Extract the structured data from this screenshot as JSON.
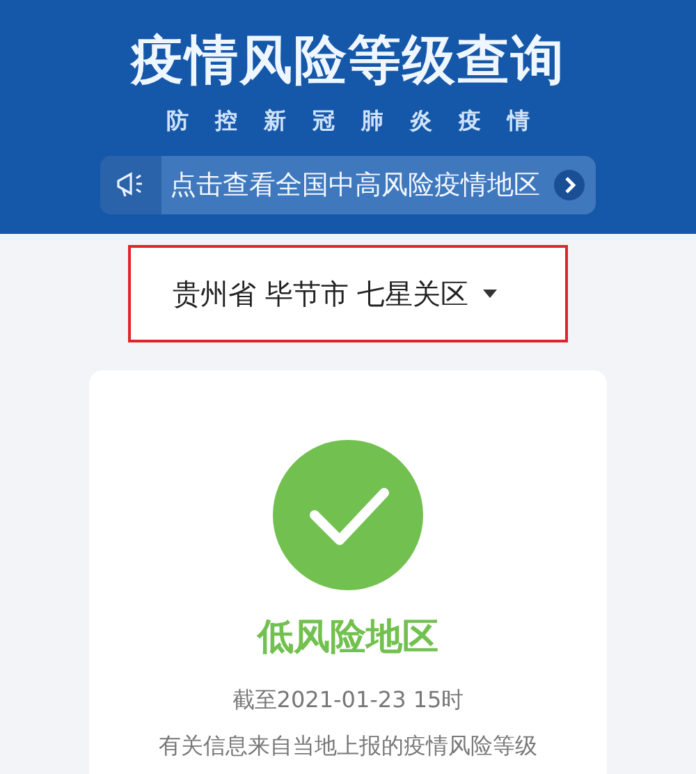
{
  "header": {
    "title": "疫情风险等级查询",
    "subtitle": [
      "防",
      "控",
      "新",
      "冠",
      "肺",
      "炎",
      "疫",
      "情"
    ],
    "notice": {
      "text": "点击查看全国中高风险疫情地区"
    }
  },
  "location": {
    "value": "贵州省 毕节市 七星关区",
    "highlighted": true
  },
  "result": {
    "kind": "low",
    "label": "低风险地区",
    "updated": "截至2021-01-23 15时",
    "note": "有关信息来自当地上报的疫情风险等级"
  }
}
